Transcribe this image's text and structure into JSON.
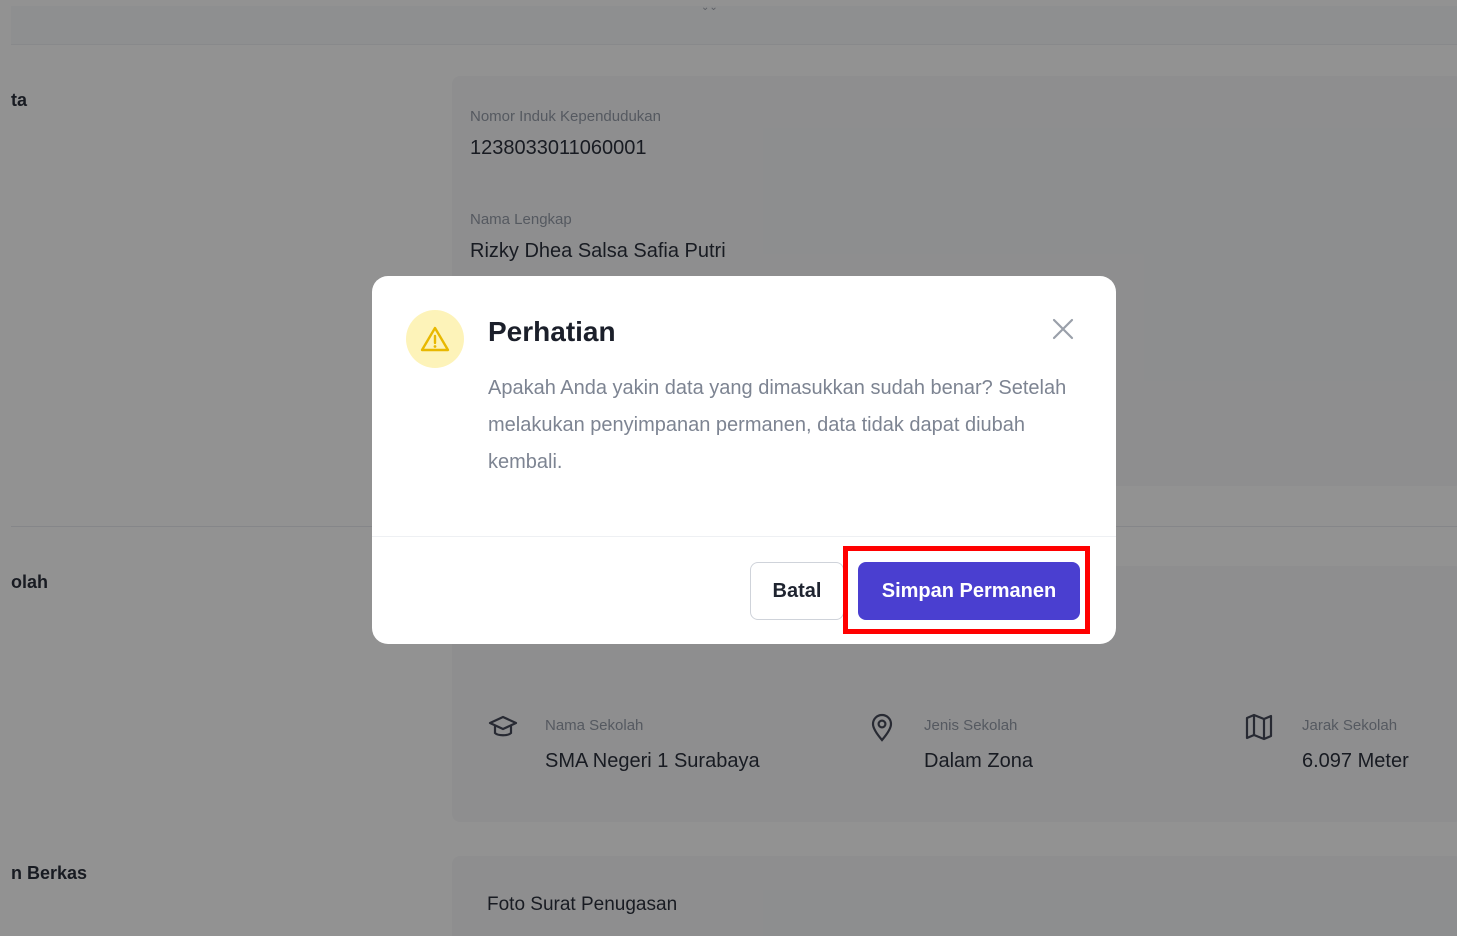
{
  "sidebar_labels": {
    "section1": "ta",
    "section2": "olah",
    "section3": "n Berkas"
  },
  "personal": {
    "nik_label": "Nomor Induk Kependudukan",
    "nik_value": "1238033011060001",
    "name_label": "Nama Lengkap",
    "name_value": "Rizky Dhea Salsa Safia Putri"
  },
  "school": {
    "name_label": "Nama Sekolah",
    "name_value": "SMA Negeri 1 Surabaya",
    "type_label": "Jenis Sekolah",
    "type_value": "Dalam Zona",
    "distance_label": "Jarak Sekolah",
    "distance_value": "6.097 Meter",
    "icons": [
      "graduation-cap-icon",
      "map-pin-icon",
      "map-icon"
    ]
  },
  "files": {
    "assignment_photo_label": "Foto Surat Penugasan"
  },
  "modal": {
    "title": "Perhatian",
    "message": "Apakah Anda yakin data yang dimasukkan sudah benar? Setelah melakukan penyimpanan permanen, data tidak dapat diubah kembali.",
    "cancel_label": "Batal",
    "confirm_label": "Simpan Permanen",
    "icon": "warning-triangle-icon",
    "colors": {
      "primary": "#4a3fd0",
      "warning_bg": "#fdf3b9",
      "warning_stroke": "#e8b800",
      "highlight": "#ff0000"
    }
  }
}
